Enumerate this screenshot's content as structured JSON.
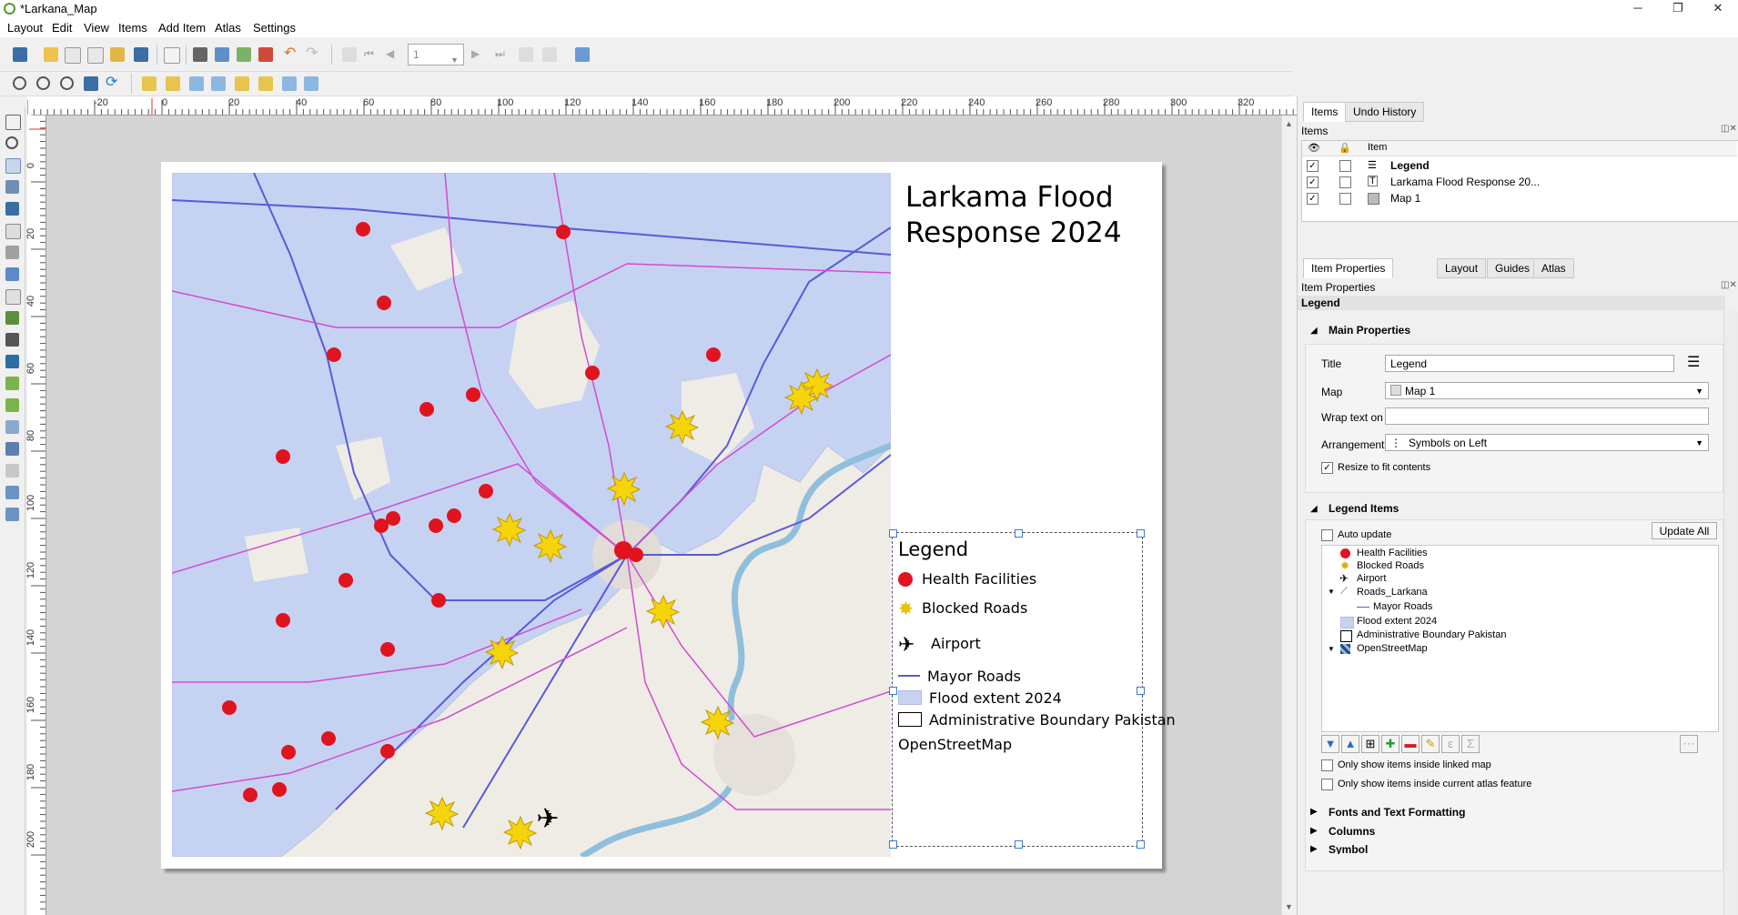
{
  "window": {
    "title": "*Larkana_Map",
    "minimize": "─",
    "restore": "❐",
    "close": "✕"
  },
  "menu": [
    "Layout",
    "Edit",
    "View",
    "Items",
    "Add Item",
    "Atlas",
    "Settings"
  ],
  "toolbar": {
    "page_value": "1"
  },
  "ruler": {
    "h_ticks": [
      "-20",
      "0",
      "20",
      "40",
      "60",
      "80",
      "100",
      "120",
      "140",
      "160",
      "180",
      "200",
      "220",
      "240",
      "260",
      "280",
      "300",
      "320"
    ],
    "v_ticks": [
      "0",
      "20",
      "40",
      "60",
      "80",
      "100",
      "120",
      "140",
      "160",
      "180",
      "200"
    ]
  },
  "layout": {
    "title": "Larkama Flood\nResponse 2024",
    "legend": {
      "title": "Legend",
      "items": [
        "Health Facilities",
        "Blocked Roads",
        "Airport",
        "Mayor Roads",
        "Flood extent 2024",
        "Administrative Boundary Pakistan",
        "OpenStreetMap"
      ]
    },
    "colors": {
      "flood": "#c6d2f2",
      "roads": "#5a5ad8",
      "minor_roads": "#d24bd2",
      "river": "#8fbfdc",
      "health": "#e0141e",
      "blocked": "#f5d40a"
    }
  },
  "panel": {
    "tabs_top": [
      "Items",
      "Undo History"
    ],
    "items_header": "Items",
    "col_item": "Item",
    "items": [
      {
        "label": "Legend",
        "bold": true,
        "checked": true
      },
      {
        "label": "Larkama Flood Response 20...",
        "bold": false,
        "checked": true
      },
      {
        "label": "Map 1",
        "bold": false,
        "checked": true
      }
    ],
    "tabs_bottom": [
      "Item Properties",
      "Layout",
      "Guides",
      "Atlas"
    ],
    "props_header": "Item Properties",
    "selected_item": "Legend",
    "main_properties": "Main Properties",
    "title_label": "Title",
    "title_value": "Legend",
    "map_label": "Map",
    "map_value": "Map 1",
    "wrap_label": "Wrap text on",
    "wrap_value": "",
    "arrangement_label": "Arrangement",
    "arrangement_value": "Symbols on Left",
    "resize_label": "Resize to fit contents",
    "legend_items_header": "Legend Items",
    "auto_update": "Auto update",
    "update_all": "Update All",
    "legend_tree": [
      "Health Facilities",
      "Blocked Roads",
      "Airport",
      "Roads_Larkana",
      "Mayor Roads",
      "Flood extent 2024",
      "Administrative Boundary Pakistan",
      "OpenStreetMap"
    ],
    "only_linked": "Only show items inside linked map",
    "only_atlas": "Only show items inside current atlas feature",
    "fonts_section": "Fonts and Text Formatting",
    "columns_section": "Columns",
    "symbol_section": "Symbol"
  }
}
